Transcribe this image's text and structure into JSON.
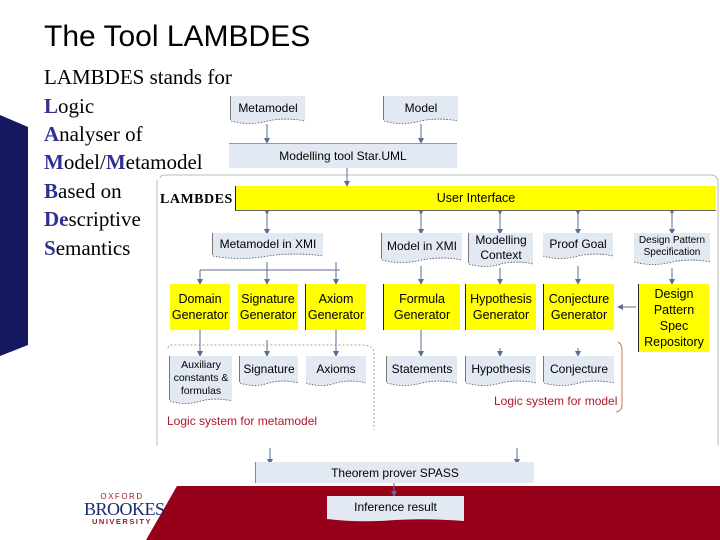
{
  "slide": {
    "title": "The Tool LAMBDES",
    "intro": "LAMBDES stands for",
    "acronym": [
      {
        "initial": "L",
        "rest": "ogic"
      },
      {
        "initial": "A",
        "rest": "nalyser of"
      },
      {
        "initial": "M",
        "rest": "odel/",
        "initial2": "M",
        "rest2": "etamodel"
      },
      {
        "initial": "B",
        "rest": "ased on"
      },
      {
        "initial": "De",
        "rest": "scriptive"
      },
      {
        "initial": "S",
        "rest": "emantics"
      }
    ]
  },
  "diagram": {
    "inputs": {
      "metamodel": "Metamodel",
      "model": "Model"
    },
    "modelling_tool": "Modelling tool Star.UML",
    "lambdes_label": "LAMBDES",
    "user_interface": "User Interface",
    "artifacts": {
      "metamodel_xmi": "Metamodel in XMI",
      "model_xmi": "Model in XMI",
      "modelling_context": [
        "Modelling",
        "Context"
      ],
      "proof_goal": "Proof Goal",
      "design_pattern_spec": [
        "Design Pattern",
        "Specification"
      ]
    },
    "generators": [
      {
        "id": "domain",
        "lines": [
          "Domain",
          "Generator"
        ]
      },
      {
        "id": "signature",
        "lines": [
          "Signature",
          "Generator"
        ]
      },
      {
        "id": "axiom",
        "lines": [
          "Axiom",
          "Generator"
        ]
      },
      {
        "id": "formula",
        "lines": [
          "Formula",
          "Generator"
        ]
      },
      {
        "id": "hypothesis",
        "lines": [
          "Hypothesis",
          "Generator"
        ]
      },
      {
        "id": "conjecture",
        "lines": [
          "Conjecture",
          "Generator"
        ]
      }
    ],
    "repository": [
      "Design",
      "Pattern",
      "Spec",
      "Repository"
    ],
    "outputs": {
      "auxiliary": [
        "Auxiliary",
        "constants &",
        "formulas"
      ],
      "signature": "Signature",
      "axioms": "Axioms",
      "statements": "Statements",
      "hypothesis": "Hypothesis",
      "conjecture": "Conjecture"
    },
    "logic_metamodel_label": "Logic system for metamodel",
    "logic_model_label": "Logic system for model",
    "theorem_prover": "Theorem prover SPASS",
    "inference_result": "Inference result"
  },
  "logo": {
    "line1": "OXFORD",
    "line2": "BROOKES",
    "line3": "UNIVERSITY"
  },
  "colors": {
    "navy": "#15185e",
    "maroon": "#960018",
    "yellow": "#ffff00",
    "doc_fill": "#e3e9f3",
    "acronym_highlight": "#2e3192",
    "red_label": "#b2182b"
  }
}
